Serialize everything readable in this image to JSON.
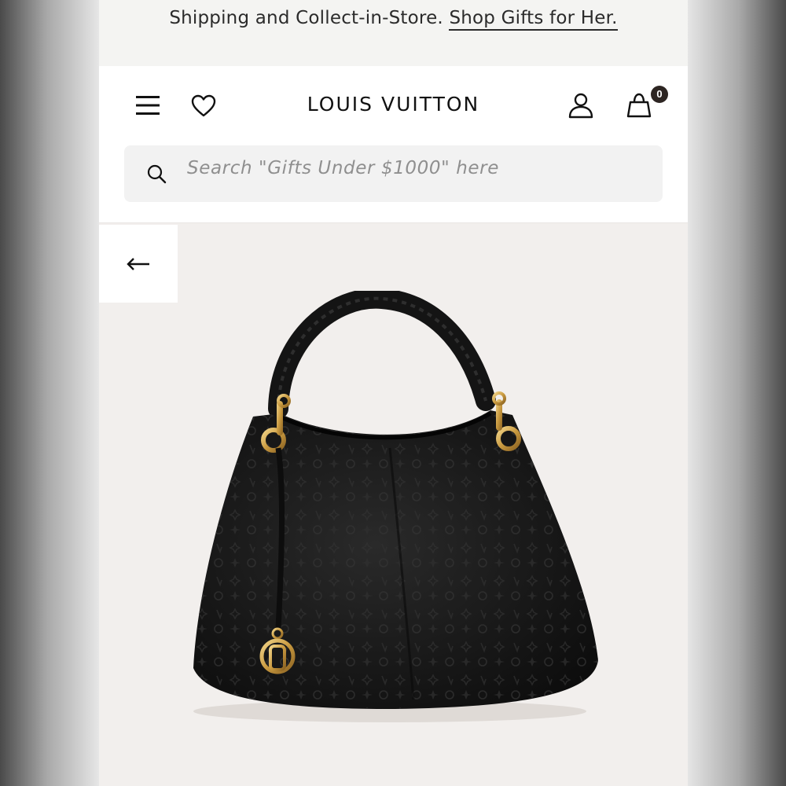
{
  "promo": {
    "text": "Shipping and Collect-in-Store.",
    "link": "Shop Gifts for Her."
  },
  "header": {
    "logo": "LOUIS VUITTON",
    "cart_count": "0",
    "icons": [
      "menu-icon",
      "heart-icon",
      "account-icon",
      "shopping-bag-icon"
    ]
  },
  "search": {
    "placeholder": "Search \"Gifts Under $1000\" here",
    "icon": "search-icon"
  },
  "nav": {
    "back_icon": "arrow-left-icon"
  },
  "colors": {
    "page_bg": "#f2efed",
    "header_bg": "#ffffff",
    "badge_bg": "#2d2522",
    "bag_leather": "#151515",
    "hardware_gold": "#c9a04a"
  }
}
